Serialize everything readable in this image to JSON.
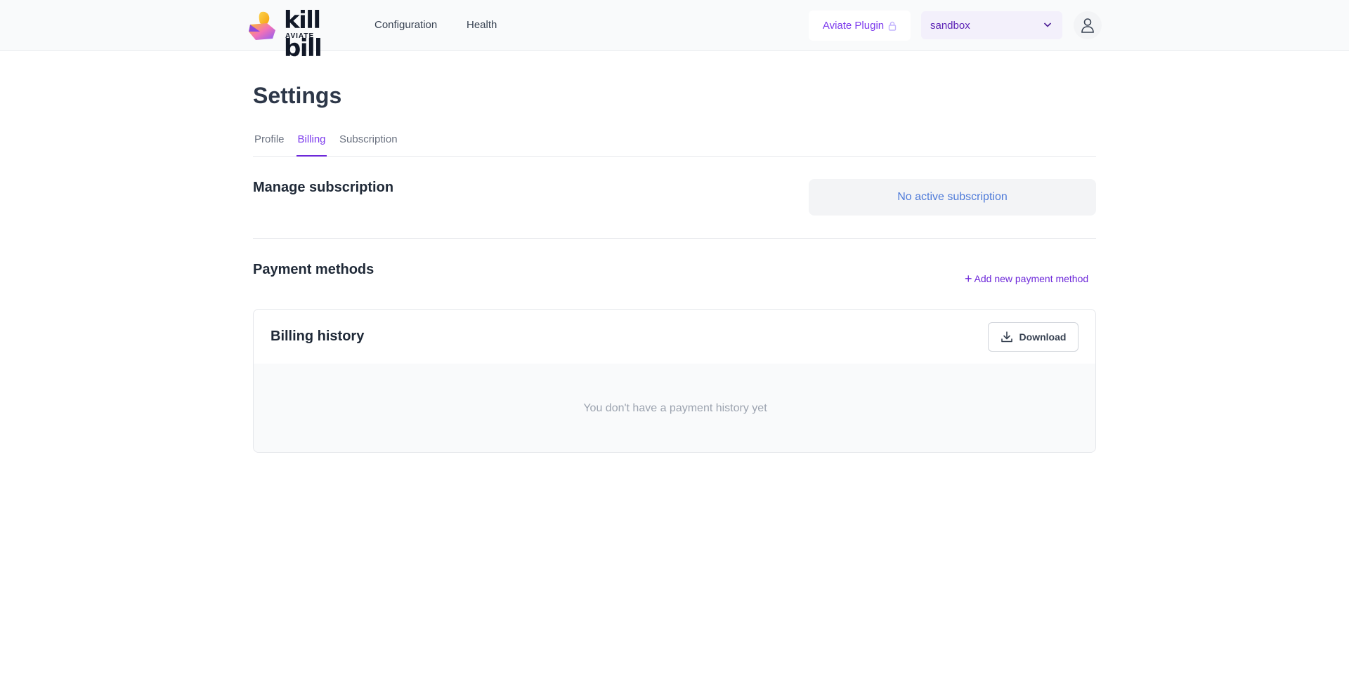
{
  "header": {
    "logo": {
      "wordmark": "kill bill",
      "subtitle": "AVIATE"
    },
    "nav": [
      {
        "label": "Configuration"
      },
      {
        "label": "Health"
      }
    ],
    "plugin_button": {
      "label": "Aviate Plugin",
      "icon": "lock-icon"
    },
    "tenant_select": {
      "value": "sandbox",
      "icon": "chevron-down-icon"
    },
    "user_menu": {
      "icon": "user-icon"
    }
  },
  "page": {
    "title": "Settings",
    "tabs": [
      {
        "label": "Profile",
        "active": false
      },
      {
        "label": "Billing",
        "active": true
      },
      {
        "label": "Subscription",
        "active": false
      }
    ]
  },
  "manage_subscription": {
    "title": "Manage subscription",
    "status_text": "No active subscription"
  },
  "payment_methods": {
    "title": "Payment methods",
    "add_label": "Add new payment method",
    "add_icon": "plus-icon"
  },
  "billing_history": {
    "title": "Billing history",
    "download_label": "Download",
    "download_icon": "download-icon",
    "empty_text": "You don't have a payment history yet"
  },
  "colors": {
    "accent": "#7c3aed",
    "accent_dark": "#6d28d9",
    "status_text": "#4f7bd9",
    "header_bg": "#f9fafb"
  }
}
